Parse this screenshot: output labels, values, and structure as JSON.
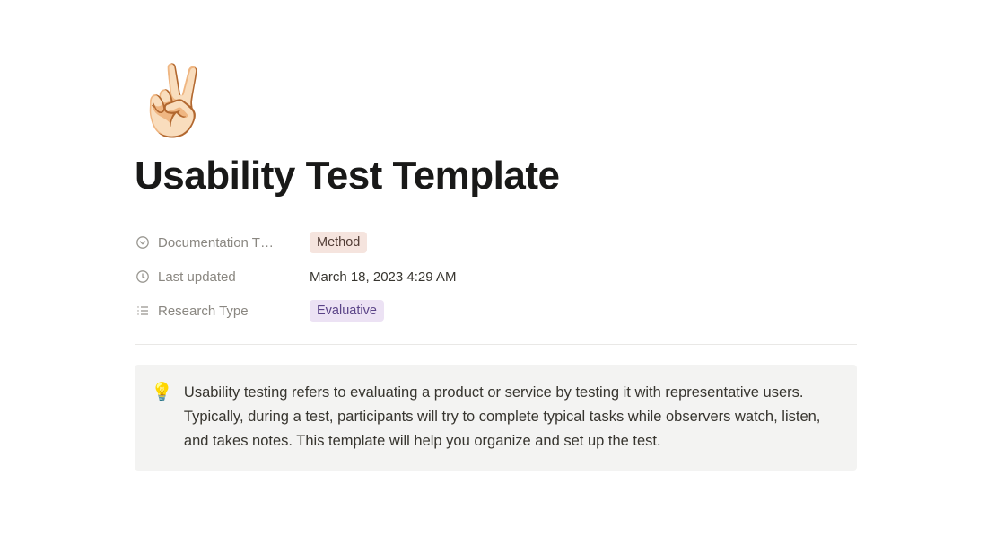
{
  "page": {
    "icon": "✌🏻",
    "title": "Usability Test Template"
  },
  "properties": {
    "doc_type": {
      "label": "Documentation T…",
      "tag": "Method"
    },
    "last_updated": {
      "label": "Last updated",
      "value": "March 18, 2023 4:29 AM"
    },
    "research_type": {
      "label": "Research Type",
      "tag": "Evaluative"
    }
  },
  "callout": {
    "icon": "💡",
    "text": "Usability testing refers to evaluating a product or service by testing it with representative users. Typically, during a test, participants will try to complete typical tasks while observers watch, listen, and takes notes. This template will help you organize and set up the test."
  }
}
